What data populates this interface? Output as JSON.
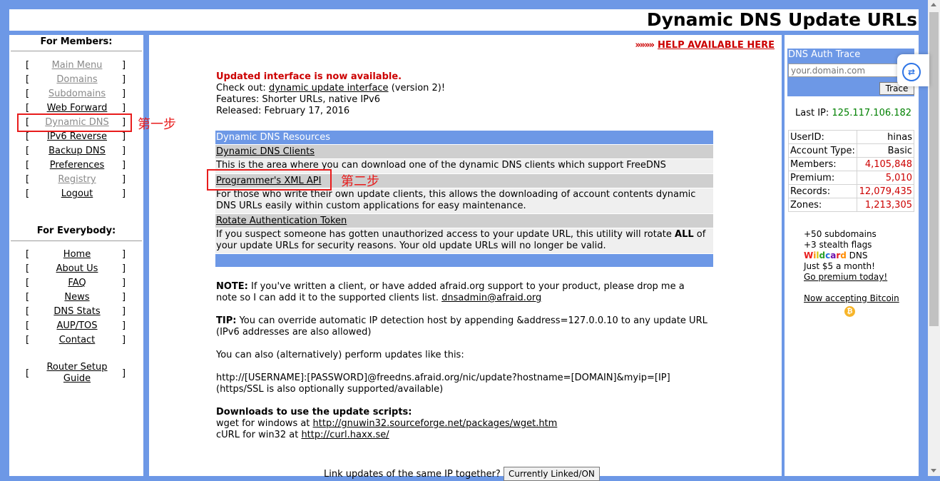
{
  "header": {
    "title": "Dynamic DNS Update URLs"
  },
  "members": {
    "title": "For Members:",
    "items": [
      {
        "label": "Main Menu"
      },
      {
        "label": "Domains"
      },
      {
        "label": "Subdomains"
      },
      {
        "label": "Web Forward"
      },
      {
        "label": "Dynamic DNS"
      },
      {
        "label": "IPv6 Reverse"
      },
      {
        "label": "Backup DNS"
      },
      {
        "label": "Preferences"
      },
      {
        "label": "Registry"
      },
      {
        "label": "Logout"
      }
    ]
  },
  "everybody": {
    "title": "For Everybody:",
    "items": [
      {
        "label": "Home"
      },
      {
        "label": "About Us"
      },
      {
        "label": "FAQ"
      },
      {
        "label": "News"
      },
      {
        "label": "DNS Stats"
      },
      {
        "label": "AUP/TOS"
      },
      {
        "label": "Contact"
      },
      {
        "label": "Router Setup Guide"
      }
    ]
  },
  "bracket_left": "[",
  "bracket_right": "]",
  "help": {
    "arrows": "»»»»",
    "label": "HELP AVAILABLE HERE"
  },
  "notice": {
    "headline": "Updated interface is now available.",
    "checkout_prefix": "Check out: ",
    "checkout_link": "dynamic update interface",
    "checkout_suffix": " (version 2)!",
    "features": "Features: Shorter URLs, native IPv6",
    "released": "Released: February 17, 2016"
  },
  "resources": {
    "header": "Dynamic DNS Resources",
    "items": [
      {
        "title": "Dynamic DNS Clients",
        "desc": "This is the area where you can download one of the dynamic DNS clients which support FreeDNS"
      },
      {
        "title": "Programmer's XML API",
        "desc": "For those who write their own update clients, this allows the downloading of account contents dynamic DNS URLs easily within custom applications for easy maintenance."
      },
      {
        "title": "Rotate Authentication Token",
        "desc_before": "If you suspect someone has gotten unauthorized access to your update URL, this utility will rotate ",
        "desc_bold": "ALL",
        "desc_after": " of your update URLs for security reasons. Your old update URLs will no longer be valid."
      }
    ]
  },
  "note": {
    "label": "NOTE:",
    "text": " If you've written a client, or have added afraid.org support to your product, please drop me a note so I can add it to the supported clients list. ",
    "email": "dnsadmin@afraid.org"
  },
  "tip": {
    "label": "TIP:",
    "text": " You can override automatic IP detection host by appending &address=127.0.0.10 to any update URL (IPv6 addresses are also allowed)"
  },
  "alt": {
    "intro": "You can also (alternatively) perform updates like this:",
    "url": "http://[USERNAME]:[PASSWORD]@freedns.afraid.org/nic/update?hostname=[DOMAIN]&myip=[IP]",
    "ssl": "(https/SSL is also optionally supported/available)"
  },
  "downloads": {
    "title": "Downloads to use the update scripts:",
    "wget_prefix": "wget for windows at ",
    "wget_url": "http://gnuwin32.sourceforge.net/packages/wget.htm",
    "curl_prefix": "cURL for win32 at ",
    "curl_url": "http://curl.haxx.se/"
  },
  "link_updates": {
    "text": "Link updates of the same IP together?",
    "button": "Currently Linked/ON"
  },
  "trace": {
    "title": "DNS Auth Trace",
    "placeholder": "your.domain.com",
    "button": "Trace"
  },
  "last_ip": {
    "label": "Last IP: ",
    "value": "125.117.106.182"
  },
  "stats": [
    {
      "label": "UserID:",
      "value": "hinas",
      "red": false
    },
    {
      "label": "Account Type:",
      "value": "Basic",
      "red": false
    },
    {
      "label": "Members:",
      "value": "4,105,848",
      "red": true
    },
    {
      "label": "Premium:",
      "value": "5,010",
      "red": true
    },
    {
      "label": "Records:",
      "value": "12,079,435",
      "red": true
    },
    {
      "label": "Zones:",
      "value": "1,213,305",
      "red": true
    }
  ],
  "promo": {
    "line1": "+50 subdomains",
    "line2": "+3 stealth flags",
    "wildcard": [
      "W",
      "i",
      "l",
      "d",
      "c",
      "a",
      "r",
      "d"
    ],
    "wildcard_colors": [
      "#e81c1c",
      "#ff8c00",
      "#d4c400",
      "#2aa02a",
      "#1e6fd9",
      "#6a0dad",
      "#e81c1c",
      "#ff8c00"
    ],
    "line3_suffix": " DNS",
    "line4": "Just $5 a month!",
    "link": "Go premium today!",
    "bitcoin": "Now accepting Bitcoin",
    "bitcoin_glyph": "₿"
  },
  "annotations": {
    "step1": "第一步",
    "step2": "第二步"
  }
}
